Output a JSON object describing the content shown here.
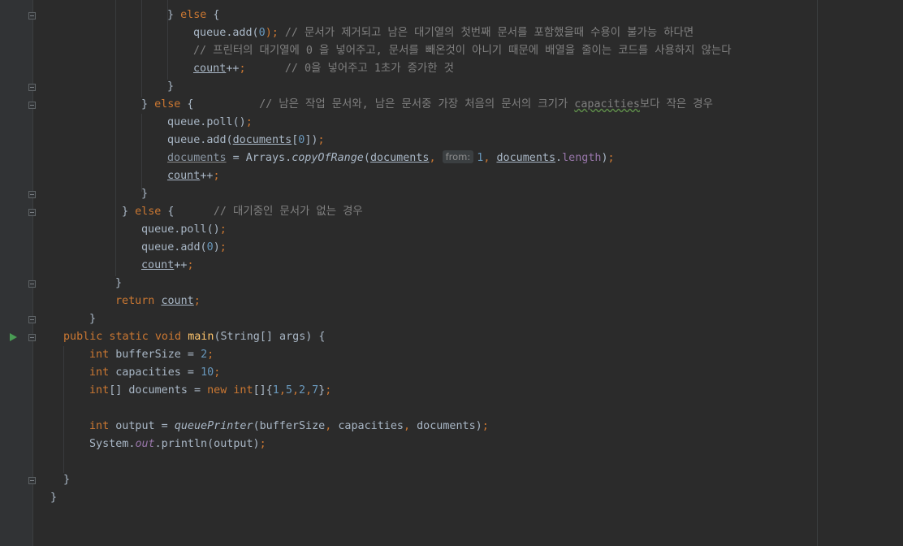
{
  "code": {
    "l1": {
      "indent": "} ",
      "else": "else",
      "brace": " {"
    },
    "l2": {
      "obj": "queue",
      "call": ".add(",
      "arg": "0",
      "end": ");",
      "comment": " // 문서가 제거되고 남은 대기열의 첫번째 문서를 포함했을때 수용이 불가능 하다면"
    },
    "l3": {
      "comment": "// 프린터의 대기열에 0 을 넣어주고, 문서를 빼온것이 아니기 때문에 배열을 줄이는 코드를 사용하지 않는다"
    },
    "l4": {
      "var": "count",
      "op": "++",
      "semi": ";",
      "comment": "      // 0을 넣어주고 1초가 증가한 것"
    },
    "l5": {
      "brace": "}"
    },
    "l6": {
      "close": "} ",
      "else": "else",
      "brace": " {",
      "comment_pre": "          // 남은 작업 문서와, 남은 문서중 가장 처음의 문서의 크기가 ",
      "comment_ref": "capacities",
      "comment_post": "보다 작은 경우"
    },
    "l7": {
      "text": "queue.poll()",
      "semi": ";"
    },
    "l8": {
      "pre": "queue.add(",
      "var": "documents",
      "idx_open": "[",
      "idx": "0",
      "idx_close": "])",
      "semi": ";"
    },
    "l9": {
      "var": "documents",
      "assign": " = Arrays.",
      "method": "copyOfRange",
      "open": "(",
      "arg1": "documents",
      "comma": ", ",
      "hint": "from:",
      "num": "1",
      "comma2": ", ",
      "arg2": "documents",
      "dot": ".",
      "field": "length",
      "close": ")",
      "semi": ";"
    },
    "l10": {
      "var": "count",
      "op": "++",
      "semi": ";"
    },
    "l11": {
      "brace": "}"
    },
    "l12": {
      "close": "} ",
      "else": "else",
      "brace": " {",
      "comment": "      // 대기중인 문서가 없는 경우"
    },
    "l13": {
      "text": "queue.poll()",
      "semi": ";"
    },
    "l14": {
      "pre": "queue.add(",
      "num": "0",
      "post": ")",
      "semi": ";"
    },
    "l15": {
      "var": "count",
      "op": "++",
      "semi": ";"
    },
    "l16": {
      "brace": "}"
    },
    "l17": {
      "kw": "return",
      "sp": " ",
      "var": "count",
      "semi": ";"
    },
    "l18": {
      "brace": "}"
    },
    "l19": {
      "kw": "public static void",
      "sp": " ",
      "fn": "main",
      "rest": "(String[] args) {"
    },
    "l20": {
      "kw": "int",
      "rest": " bufferSize = ",
      "num": "2",
      "semi": ";"
    },
    "l21": {
      "kw": "int",
      "rest": " capacities = ",
      "num": "10",
      "semi": ";"
    },
    "l22": {
      "kw": "int",
      "arr": "[] documents = ",
      "new": "new",
      "sp": " ",
      "kw2": "int",
      "init_open": "[]{",
      "n1": "1",
      "c1": ",",
      "n2": "5",
      "c2": ",",
      "n3": "2",
      "c3": ",",
      "n4": "7",
      "init_close": "}",
      "semi": ";"
    },
    "l23": {
      "kw": "int",
      "rest": " output = ",
      "method": "queuePrinter",
      "open": "(bufferSize",
      "c1": ", ",
      "a2": "capacities",
      "c2": ", ",
      "a3": "documents)",
      "semi": ";"
    },
    "l24": {
      "pre": "System.",
      "out": "out",
      "post": ".println(output)",
      "semi": ";"
    },
    "l25": {
      "brace": "}"
    },
    "l26": {
      "brace": "}"
    }
  }
}
